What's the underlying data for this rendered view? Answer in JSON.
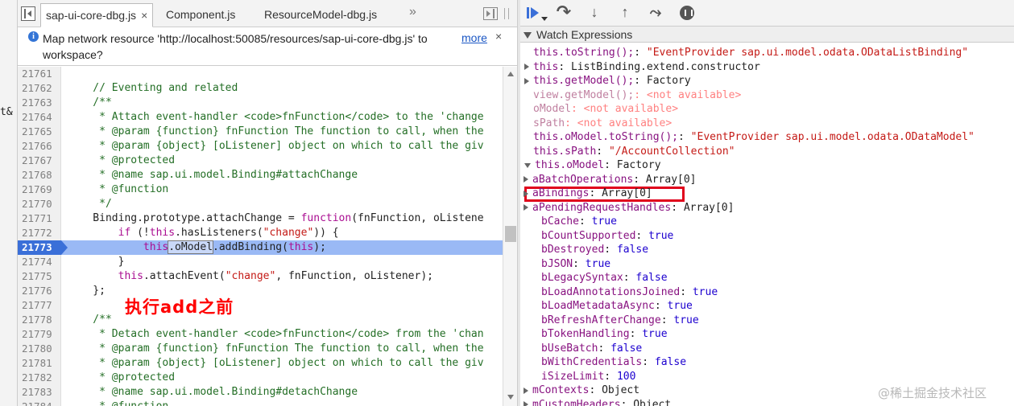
{
  "left_strip": {
    "cut_text": "t&"
  },
  "editor": {
    "tabs": [
      {
        "label": "sap-ui-core-dbg.js",
        "active": true,
        "close": "×"
      },
      {
        "label": "Component.js",
        "active": false
      },
      {
        "label": "ResourceModel-dbg.js",
        "active": false
      }
    ],
    "more_tabs": "»",
    "info_bar": {
      "message": "Map network resource 'http://localhost:50085/resources/sap-ui-core-dbg.js' to workspace?",
      "more_label": "more",
      "close": "×"
    },
    "code_lines": [
      {
        "num": "21761",
        "parts": []
      },
      {
        "num": "21762",
        "parts": [
          {
            "t": "    // Eventing and related",
            "c": "comment"
          }
        ]
      },
      {
        "num": "21763",
        "parts": [
          {
            "t": "    /**",
            "c": "comment"
          }
        ]
      },
      {
        "num": "21764",
        "parts": [
          {
            "t": "     * Attach event-handler <code>fnFunction</code> to the 'change",
            "c": "comment"
          }
        ]
      },
      {
        "num": "21765",
        "parts": [
          {
            "t": "     * @param {function} fnFunction The function to call, when the",
            "c": "comment"
          }
        ]
      },
      {
        "num": "21766",
        "parts": [
          {
            "t": "     * @param {object} [oListener] object on which to call the giv",
            "c": "comment"
          }
        ]
      },
      {
        "num": "21767",
        "parts": [
          {
            "t": "     * @protected",
            "c": "comment"
          }
        ]
      },
      {
        "num": "21768",
        "parts": [
          {
            "t": "     * @name sap.ui.model.Binding#attachChange",
            "c": "comment"
          }
        ]
      },
      {
        "num": "21769",
        "parts": [
          {
            "t": "     * @function",
            "c": "comment"
          }
        ]
      },
      {
        "num": "21770",
        "parts": [
          {
            "t": "     */",
            "c": "comment"
          }
        ]
      },
      {
        "num": "21771",
        "parts": [
          {
            "t": "    Binding.prototype.attachChange = ",
            "c": "plain"
          },
          {
            "t": "function",
            "c": "keyword"
          },
          {
            "t": "(fnFunction, oListene",
            "c": "plain"
          }
        ]
      },
      {
        "num": "21772",
        "parts": [
          {
            "t": "        ",
            "c": "plain"
          },
          {
            "t": "if",
            "c": "keyword"
          },
          {
            "t": " (!",
            "c": "plain"
          },
          {
            "t": "this",
            "c": "keyword"
          },
          {
            "t": ".hasListeners(",
            "c": "plain"
          },
          {
            "t": "\"change\"",
            "c": "string"
          },
          {
            "t": ")) {",
            "c": "plain"
          }
        ]
      },
      {
        "num": "21773",
        "current": true,
        "parts": [
          {
            "t": "            ",
            "c": "plain"
          },
          {
            "t": "this",
            "c": "keyword"
          },
          {
            "t": ".oModel",
            "c": "plain",
            "box": true
          },
          {
            "t": ".addBinding(",
            "c": "plain"
          },
          {
            "t": "this",
            "c": "keyword"
          },
          {
            "t": ");",
            "c": "plain"
          }
        ]
      },
      {
        "num": "21774",
        "parts": [
          {
            "t": "        }",
            "c": "plain"
          }
        ]
      },
      {
        "num": "21775",
        "parts": [
          {
            "t": "        ",
            "c": "plain"
          },
          {
            "t": "this",
            "c": "keyword"
          },
          {
            "t": ".attachEvent(",
            "c": "plain"
          },
          {
            "t": "\"change\"",
            "c": "string"
          },
          {
            "t": ", fnFunction, oListener);",
            "c": "plain"
          }
        ]
      },
      {
        "num": "21776",
        "parts": [
          {
            "t": "    };",
            "c": "plain"
          }
        ]
      },
      {
        "num": "21777",
        "parts": []
      },
      {
        "num": "21778",
        "parts": [
          {
            "t": "    /**",
            "c": "comment"
          }
        ]
      },
      {
        "num": "21779",
        "parts": [
          {
            "t": "     * Detach event-handler <code>fnFunction</code> from the 'chan",
            "c": "comment"
          }
        ]
      },
      {
        "num": "21780",
        "parts": [
          {
            "t": "     * @param {function} fnFunction The function to call, when the",
            "c": "comment"
          }
        ]
      },
      {
        "num": "21781",
        "parts": [
          {
            "t": "     * @param {object} [oListener] object on which to call the giv",
            "c": "comment"
          }
        ]
      },
      {
        "num": "21782",
        "parts": [
          {
            "t": "     * @protected",
            "c": "comment"
          }
        ]
      },
      {
        "num": "21783",
        "parts": [
          {
            "t": "     * @name sap.ui.model.Binding#detachChange",
            "c": "comment"
          }
        ]
      },
      {
        "num": "21784",
        "parts": [
          {
            "t": "     * @function",
            "c": "comment"
          }
        ]
      }
    ],
    "annotation": "执行add之前"
  },
  "debugger": {
    "watch_title": "Watch Expressions",
    "watch_items": [
      {
        "indent": 0,
        "tw": "none",
        "parts": [
          {
            "t": "this.toString();",
            "c": "k"
          },
          {
            "t": ": ",
            "c": "o"
          },
          {
            "t": "\"EventProvider sap.ui.model.odata.ODataListBinding\"",
            "c": "s"
          }
        ]
      },
      {
        "indent": 0,
        "tw": "closed",
        "parts": [
          {
            "t": "this",
            "c": "k"
          },
          {
            "t": ": ListBinding.extend.constructor",
            "c": "o"
          }
        ]
      },
      {
        "indent": 0,
        "tw": "closed",
        "parts": [
          {
            "t": "this.getModel();",
            "c": "k"
          },
          {
            "t": ": Factory",
            "c": "o"
          }
        ]
      },
      {
        "indent": 0,
        "tw": "none",
        "parts": [
          {
            "t": "view.getModel();",
            "c": "kd"
          },
          {
            "t": ": ",
            "c": "na"
          },
          {
            "t": "<not available>",
            "c": "na"
          }
        ]
      },
      {
        "indent": 0,
        "tw": "none",
        "parts": [
          {
            "t": "oModel",
            "c": "kd"
          },
          {
            "t": ": ",
            "c": "na"
          },
          {
            "t": "<not available>",
            "c": "na"
          }
        ]
      },
      {
        "indent": 0,
        "tw": "none",
        "parts": [
          {
            "t": "sPath",
            "c": "kd"
          },
          {
            "t": ": ",
            "c": "na"
          },
          {
            "t": "<not available>",
            "c": "na"
          }
        ]
      },
      {
        "indent": 0,
        "tw": "none",
        "parts": [
          {
            "t": "this.oModel.toString();",
            "c": "k"
          },
          {
            "t": ": ",
            "c": "o"
          },
          {
            "t": "\"EventProvider sap.ui.model.odata.ODataModel\"",
            "c": "s"
          }
        ]
      },
      {
        "indent": 0,
        "tw": "none",
        "parts": [
          {
            "t": "this.sPath",
            "c": "k"
          },
          {
            "t": ": ",
            "c": "o"
          },
          {
            "t": "\"/AccountCollection\"",
            "c": "s"
          }
        ]
      },
      {
        "indent": 0,
        "tw": "open",
        "parts": [
          {
            "t": "this.oModel",
            "c": "k"
          },
          {
            "t": ": Factory",
            "c": "o"
          }
        ]
      },
      {
        "indent": 1,
        "tw": "closed",
        "parts": [
          {
            "t": "aBatchOperations",
            "c": "k"
          },
          {
            "t": ": Array[0]",
            "c": "o"
          }
        ]
      },
      {
        "indent": 1,
        "tw": "closed",
        "parts": [
          {
            "t": "aBindings",
            "c": "k"
          },
          {
            "t": ": Array[0]",
            "c": "o"
          }
        ]
      },
      {
        "indent": 1,
        "tw": "closed",
        "parts": [
          {
            "t": "aPendingRequestHandles",
            "c": "k"
          },
          {
            "t": ": Array[0]",
            "c": "o"
          }
        ]
      },
      {
        "indent": 2,
        "tw": "none",
        "parts": [
          {
            "t": "bCache",
            "c": "k"
          },
          {
            "t": ": ",
            "c": "o"
          },
          {
            "t": "true",
            "c": "n"
          }
        ]
      },
      {
        "indent": 2,
        "tw": "none",
        "parts": [
          {
            "t": "bCountSupported",
            "c": "k"
          },
          {
            "t": ": ",
            "c": "o"
          },
          {
            "t": "true",
            "c": "n"
          }
        ]
      },
      {
        "indent": 2,
        "tw": "none",
        "parts": [
          {
            "t": "bDestroyed",
            "c": "k"
          },
          {
            "t": ": ",
            "c": "o"
          },
          {
            "t": "false",
            "c": "n"
          }
        ]
      },
      {
        "indent": 2,
        "tw": "none",
        "parts": [
          {
            "t": "bJSON",
            "c": "k"
          },
          {
            "t": ": ",
            "c": "o"
          },
          {
            "t": "true",
            "c": "n"
          }
        ]
      },
      {
        "indent": 2,
        "tw": "none",
        "parts": [
          {
            "t": "bLegacySyntax",
            "c": "k"
          },
          {
            "t": ": ",
            "c": "o"
          },
          {
            "t": "false",
            "c": "n"
          }
        ]
      },
      {
        "indent": 2,
        "tw": "none",
        "parts": [
          {
            "t": "bLoadAnnotationsJoined",
            "c": "k"
          },
          {
            "t": ": ",
            "c": "o"
          },
          {
            "t": "true",
            "c": "n"
          }
        ]
      },
      {
        "indent": 2,
        "tw": "none",
        "parts": [
          {
            "t": "bLoadMetadataAsync",
            "c": "k"
          },
          {
            "t": ": ",
            "c": "o"
          },
          {
            "t": "true",
            "c": "n"
          }
        ]
      },
      {
        "indent": 2,
        "tw": "none",
        "parts": [
          {
            "t": "bRefreshAfterChange",
            "c": "k"
          },
          {
            "t": ": ",
            "c": "o"
          },
          {
            "t": "true",
            "c": "n"
          }
        ]
      },
      {
        "indent": 2,
        "tw": "none",
        "parts": [
          {
            "t": "bTokenHandling",
            "c": "k"
          },
          {
            "t": ": ",
            "c": "o"
          },
          {
            "t": "true",
            "c": "n"
          }
        ]
      },
      {
        "indent": 2,
        "tw": "none",
        "parts": [
          {
            "t": "bUseBatch",
            "c": "k"
          },
          {
            "t": ": ",
            "c": "o"
          },
          {
            "t": "false",
            "c": "n"
          }
        ]
      },
      {
        "indent": 2,
        "tw": "none",
        "parts": [
          {
            "t": "bWithCredentials",
            "c": "k"
          },
          {
            "t": ": ",
            "c": "o"
          },
          {
            "t": "false",
            "c": "n"
          }
        ]
      },
      {
        "indent": 2,
        "tw": "none",
        "parts": [
          {
            "t": "iSizeLimit",
            "c": "k"
          },
          {
            "t": ": ",
            "c": "o"
          },
          {
            "t": "100",
            "c": "n"
          }
        ]
      },
      {
        "indent": 1,
        "tw": "closed",
        "parts": [
          {
            "t": "mContexts",
            "c": "k"
          },
          {
            "t": ": Object",
            "c": "o"
          }
        ]
      },
      {
        "indent": 1,
        "tw": "closed",
        "parts": [
          {
            "t": "mCustomHeaders",
            "c": "k"
          },
          {
            "t": ": Object",
            "c": "o"
          }
        ]
      }
    ]
  },
  "watermark": "@稀土掘金技术社区",
  "colors": {
    "current_line": "#9ab9f5",
    "current_line_number": "#3a6fd8",
    "highlight_box": "#e0001b",
    "annotation": "#ff0000"
  }
}
